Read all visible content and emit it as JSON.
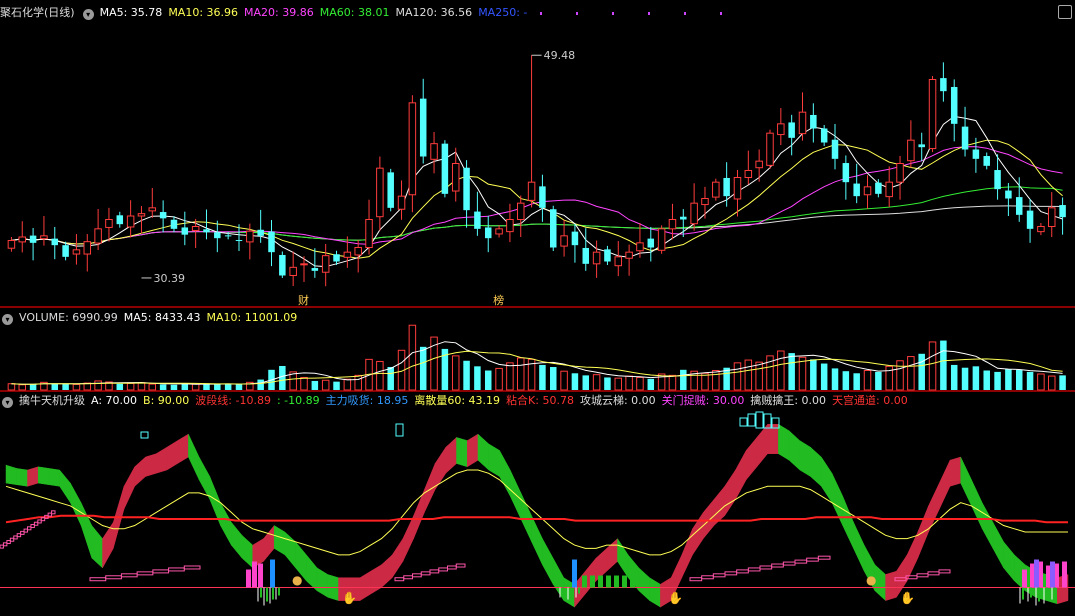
{
  "header_main": {
    "stock_name": "聚石化学",
    "period": "(日线)",
    "ma": [
      {
        "label": "MA5: 35.78",
        "color": "#ffffff"
      },
      {
        "label": "MA10: 36.96",
        "color": "#ffff55"
      },
      {
        "label": "MA20: 39.86",
        "color": "#ff44ff"
      },
      {
        "label": "MA60: 38.01",
        "color": "#33ee33"
      },
      {
        "label": "MA120: 36.56",
        "color": "#dddddd"
      },
      {
        "label": "MA250: -",
        "color": "#3355ff"
      }
    ]
  },
  "header_volume": {
    "items": [
      {
        "label": "VOLUME: 6990.99",
        "color": "#dddddd"
      },
      {
        "label": "MA5: 8433.43",
        "color": "#ffffff"
      },
      {
        "label": "MA10: 11001.09",
        "color": "#ffff55"
      }
    ]
  },
  "header_indicator": {
    "items": [
      {
        "label": "擒牛天机升级",
        "color": "#dddddd"
      },
      {
        "label": "A: 70.00",
        "color": "#ffffff"
      },
      {
        "label": "B: 90.00",
        "color": "#ffff55"
      },
      {
        "label": "波段线: -10.89",
        "color": "#ff3333"
      },
      {
        "label": ": -10.89",
        "color": "#33ee33"
      },
      {
        "label": "主力吸货: 18.95",
        "color": "#3399ff"
      },
      {
        "label": "离散量60: 43.19",
        "color": "#ffff55"
      },
      {
        "label": "粘合K: 50.78",
        "color": "#ff3333"
      },
      {
        "label": "攻城云梯: 0.00",
        "color": "#dddddd"
      },
      {
        "label": "关门捉贼: 30.00",
        "color": "#ff44ff"
      },
      {
        "label": "擒贼擒王: 0.00",
        "color": "#dddddd"
      },
      {
        "label": "天宫通道: 0.00",
        "color": "#ff3333"
      }
    ]
  },
  "colors": {
    "up": "#ff3c3c",
    "down": "#54ffff",
    "ma5": "#ffffff",
    "ma10": "#ffff55",
    "ma20": "#ff44ff",
    "ma60": "#33ee33",
    "ma120": "#dddddd",
    "grid": "#8b0000"
  },
  "chart_data": {
    "type": "candlestick",
    "price_range": [
      28.5,
      52.5
    ],
    "annotations": [
      {
        "text": "49.48",
        "x": 48,
        "price": 49.48
      },
      {
        "text": "30.39",
        "x": 12,
        "price": 30.39
      },
      {
        "text": "财",
        "x": 27,
        "price": null
      },
      {
        "text": "榜",
        "x": 45,
        "price": null
      }
    ],
    "close": [
      33.6,
      33.9,
      33.4,
      34.0,
      33.2,
      32.2,
      32.8,
      33.5,
      34.6,
      35.4,
      35.0,
      35.7,
      35.9,
      36.4,
      35.5,
      34.6,
      34.1,
      34.8,
      34.3,
      33.8,
      34.0,
      33.6,
      34.4,
      34.0,
      32.6,
      30.6,
      31.3,
      31.6,
      31.0,
      32.3,
      31.8,
      32.6,
      33.0,
      35.4,
      39.8,
      36.4,
      37.4,
      45.4,
      40.8,
      41.9,
      37.6,
      40.2,
      36.2,
      34.6,
      33.8,
      34.6,
      35.4,
      36.8,
      38.6,
      36.4,
      33.0,
      34.0,
      33.2,
      31.6,
      32.6,
      31.8,
      32.2,
      32.6,
      33.4,
      33.0,
      34.6,
      35.4,
      35.4,
      36.8,
      37.2,
      38.6,
      37.4,
      39.0,
      39.6,
      40.4,
      42.8,
      43.6,
      42.4,
      44.6,
      43.2,
      42.0,
      40.6,
      38.6,
      37.4,
      38.2,
      37.6,
      38.6,
      40.2,
      42.2,
      41.6,
      47.4,
      46.4,
      43.6,
      41.4,
      40.6,
      40.0,
      38.0,
      37.2,
      35.8,
      34.6,
      34.8,
      36.4,
      35.6
    ],
    "volume": [
      1800,
      1500,
      1600,
      2200,
      1900,
      1700,
      1600,
      2000,
      2600,
      2300,
      1800,
      1900,
      2100,
      1700,
      1600,
      1500,
      1800,
      1700,
      1900,
      1600,
      1700,
      1600,
      2200,
      3000,
      5800,
      6900,
      5200,
      3600,
      2600,
      2800,
      2400,
      3100,
      4200,
      8800,
      8200,
      6600,
      11400,
      18600,
      12400,
      15200,
      11800,
      9800,
      8400,
      6800,
      5600,
      6200,
      7800,
      9200,
      8800,
      7200,
      6600,
      5400,
      4800,
      4200,
      4400,
      3600,
      3400,
      4000,
      3600,
      3200,
      4600,
      4200,
      5800,
      5400,
      4800,
      5600,
      6400,
      7800,
      8600,
      8000,
      9800,
      11200,
      10600,
      9400,
      8800,
      7600,
      6200,
      5400,
      4800,
      5600,
      5200,
      6800,
      8400,
      9600,
      10400,
      13800,
      14200,
      7200,
      6400,
      6800,
      5600,
      5200,
      6000,
      5800,
      5200,
      4600,
      4000,
      4200
    ],
    "ma": {
      "ma5": "computed from close",
      "ma10": "computed from close",
      "ma20": "computed from close",
      "ma60": "computed from close",
      "ma120": "computed from close"
    },
    "indicator": {
      "range": [
        -15,
        110
      ],
      "band_upper": [
        75,
        73,
        72,
        74,
        73,
        72,
        64,
        52,
        38,
        30,
        40,
        62,
        74,
        80,
        82,
        86,
        90,
        94,
        80,
        68,
        52,
        40,
        32,
        26,
        30,
        38,
        34,
        28,
        20,
        12,
        8,
        6,
        6,
        6,
        10,
        14,
        20,
        30,
        44,
        60,
        76,
        86,
        92,
        90,
        94,
        88,
        84,
        72,
        58,
        44,
        30,
        18,
        6,
        2,
        10,
        18,
        24,
        30,
        20,
        12,
        6,
        2,
        6,
        20,
        36,
        46,
        54,
        62,
        72,
        84,
        92,
        100,
        100,
        96,
        90,
        86,
        80,
        70,
        56,
        40,
        26,
        14,
        8,
        10,
        20,
        34,
        50,
        64,
        78,
        80,
        66,
        52,
        40,
        28,
        20,
        14,
        10,
        8,
        6,
        8
      ],
      "band_lower": [
        70,
        69,
        68,
        70,
        69,
        68,
        58,
        44,
        24,
        18,
        30,
        54,
        68,
        74,
        76,
        78,
        82,
        86,
        72,
        60,
        44,
        32,
        24,
        18,
        22,
        30,
        26,
        18,
        10,
        4,
        0,
        -2,
        -2,
        -2,
        2,
        6,
        12,
        22,
        36,
        52,
        66,
        76,
        82,
        80,
        84,
        78,
        74,
        62,
        48,
        34,
        20,
        8,
        -2,
        -6,
        2,
        10,
        16,
        22,
        12,
        4,
        -2,
        -6,
        -2,
        12,
        26,
        36,
        44,
        50,
        60,
        72,
        80,
        88,
        88,
        84,
        78,
        74,
        68,
        58,
        44,
        30,
        16,
        4,
        -2,
        0,
        10,
        24,
        40,
        54,
        68,
        70,
        56,
        42,
        30,
        18,
        10,
        4,
        0,
        -2,
        -4,
        -2
      ],
      "red_line": [
        40,
        41,
        42,
        43,
        43,
        44,
        44,
        44,
        44,
        43,
        43,
        43,
        43,
        43,
        42,
        42,
        42,
        42,
        42,
        42,
        42,
        41,
        41,
        41,
        41,
        41,
        41,
        41,
        41,
        41,
        41,
        41,
        41,
        41,
        41,
        41,
        42,
        42,
        42,
        42,
        43,
        43,
        43,
        43,
        43,
        43,
        43,
        42,
        42,
        42,
        42,
        42,
        41,
        41,
        41,
        41,
        41,
        41,
        41,
        41,
        41,
        41,
        41,
        41,
        41,
        41,
        41,
        41,
        41,
        42,
        42,
        42,
        42,
        42,
        43,
        43,
        43,
        43,
        43,
        43,
        42,
        42,
        42,
        42,
        42,
        42,
        42,
        42,
        42,
        42,
        42,
        41,
        41,
        41,
        41,
        40,
        40,
        40
      ],
      "yellow_line": [
        62,
        60,
        58,
        56,
        54,
        52,
        50,
        46,
        42,
        38,
        36,
        36,
        38,
        42,
        46,
        50,
        54,
        58,
        58,
        56,
        52,
        46,
        40,
        36,
        34,
        32,
        30,
        28,
        26,
        24,
        22,
        20,
        20,
        22,
        26,
        30,
        36,
        44,
        52,
        58,
        62,
        66,
        70,
        72,
        72,
        70,
        66,
        60,
        54,
        48,
        42,
        36,
        30,
        26,
        24,
        24,
        26,
        26,
        24,
        22,
        20,
        20,
        22,
        26,
        32,
        38,
        44,
        50,
        54,
        58,
        60,
        62,
        62,
        62,
        62,
        60,
        56,
        52,
        48,
        44,
        40,
        36,
        32,
        30,
        30,
        32,
        36,
        42,
        48,
        52,
        50,
        46,
        42,
        38,
        36,
        34,
        34,
        34,
        34,
        34
      ]
    }
  }
}
